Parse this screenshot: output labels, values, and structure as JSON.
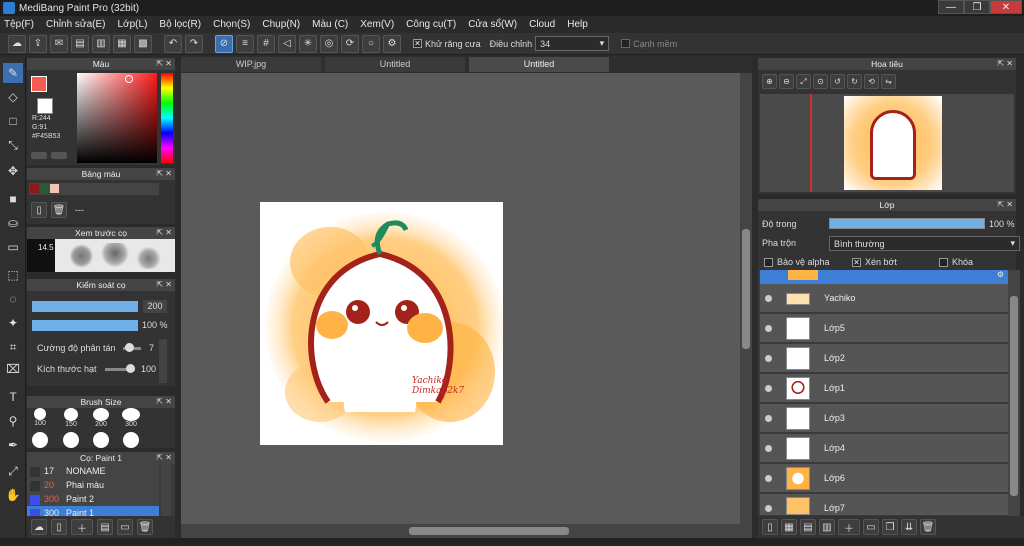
{
  "window": {
    "title": "MediBang Paint Pro (32bit)",
    "btn_min": "—",
    "btn_max": "❐",
    "btn_close": "✕"
  },
  "menu": [
    "Tệp(F)",
    "Chỉnh sửa(E)",
    "Lớp(L)",
    "Bộ lọc(R)",
    "Chọn(S)",
    "Chụp(N)",
    "Màu (C)",
    "Xem(V)",
    "Công cụ(T)",
    "Cửa sổ(W)",
    "Cloud",
    "Help"
  ],
  "toolbar": {
    "antialias_label": "Khử răng cưa",
    "correction_label": "Điều chỉnh",
    "correction_value": "34",
    "edge_label": "Cạnh mềm"
  },
  "color_panel": {
    "title": "Màu",
    "r": "R:244",
    "g": "G:91",
    "hex": "#F45B53",
    "fg": "#f45b53"
  },
  "palette_panel": {
    "title": "Bảng màu",
    "dashes": "---"
  },
  "brush_preview": {
    "title": "Xem trước cọ",
    "size": "14.5"
  },
  "brush_control": {
    "title": "Kiểm soát cọ",
    "size_value": "200",
    "opacity_value": "100 %",
    "scatter_label": "Cường độ phân tán",
    "scatter_value": "7",
    "grain_label": "Kích thước hạt",
    "grain_value": "100"
  },
  "brush_size": {
    "title": "Brush Size",
    "sizes": [
      "100",
      "150",
      "200",
      "300"
    ]
  },
  "brush_list": {
    "title": "Cọ: Paint 1",
    "items": [
      {
        "num": "17",
        "name": "NONAME"
      },
      {
        "num": "20",
        "name": "Phai màu"
      },
      {
        "num": "300",
        "name": "Paint 2"
      },
      {
        "num": "300",
        "name": "Paint 1"
      }
    ]
  },
  "tabs": [
    "WIP.jpg",
    "Untitled",
    "Untitled"
  ],
  "artwork": {
    "signature": "Yachiko Dimkap2k7"
  },
  "navigator": {
    "title": "Hoa tiêu"
  },
  "layers": {
    "title": "Lớp",
    "opacity_label": "Độ trong",
    "opacity_value": "100 %",
    "blend_label": "Pha trộn",
    "blend_value": "Bình thường",
    "protect_alpha": "Bảo vệ alpha",
    "clipping": "Xén bớt",
    "lock": "Khóa",
    "items": [
      "Yachiko",
      "Lớp5",
      "Lớp2",
      "Lớp1",
      "Lớp3",
      "Lớp4",
      "Lớp6",
      "Lớp7"
    ]
  }
}
